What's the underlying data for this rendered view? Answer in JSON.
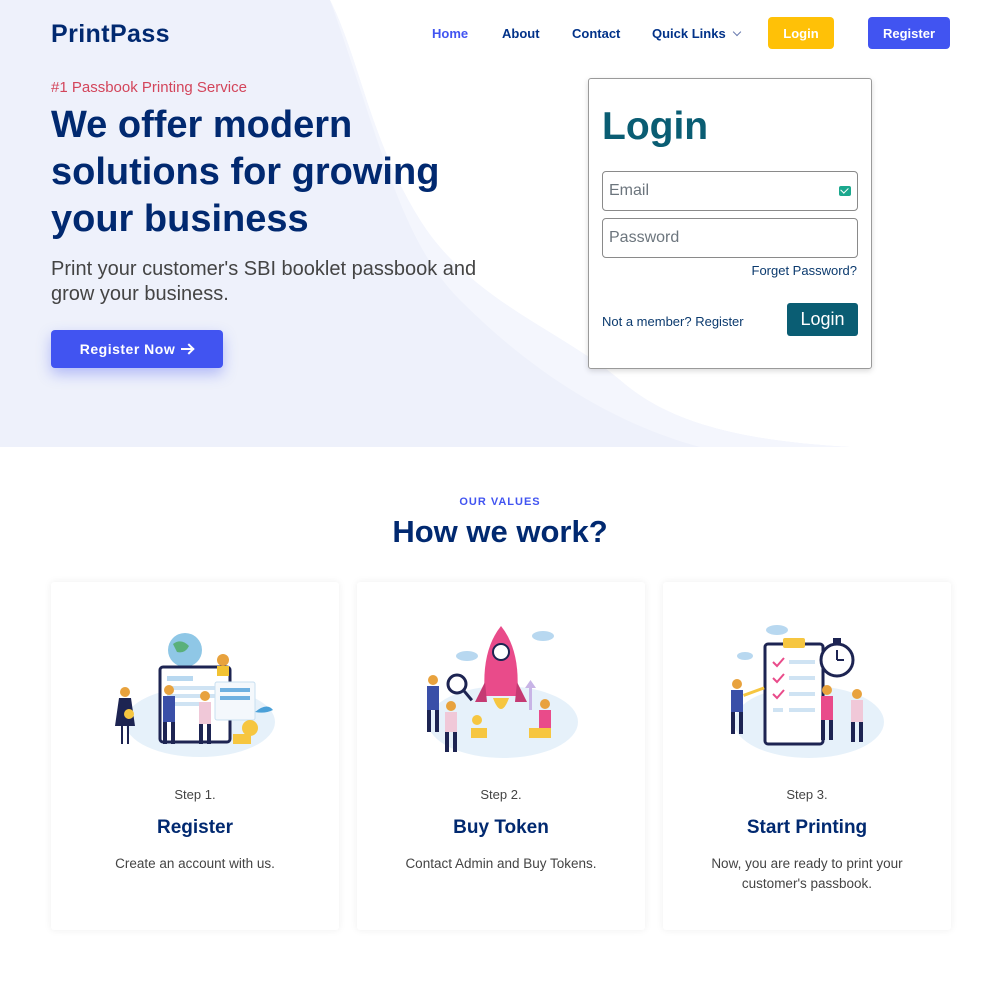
{
  "colors": {
    "primary": "#4154f1",
    "navy": "#012970",
    "teal": "#0a5d73",
    "yellow": "#ffc107",
    "tagline_red": "#d3455b",
    "hero_bg": "#eef1fb"
  },
  "header": {
    "logo": "PrintPass",
    "nav": {
      "home": "Home",
      "about": "About",
      "contact": "Contact",
      "quick_links": "Quick Links"
    },
    "login_button": "Login",
    "register_button": "Register"
  },
  "hero": {
    "tagline": "#1 Passbook Printing Service",
    "headline": "We offer modern solutions for growing your business",
    "subline": "Print your customer's SBI booklet passbook and grow your business.",
    "cta": "Register Now"
  },
  "login_card": {
    "title": "Login",
    "email_placeholder": "Email",
    "password_placeholder": "Password",
    "forget_password": "Forget Password?",
    "not_member": "Not a member? Register",
    "submit": "Login"
  },
  "values": {
    "kicker": "OUR VALUES",
    "title": "How we work?",
    "cards": [
      {
        "step": "Step 1.",
        "title": "Register",
        "description": "Create an account with us.",
        "illustration": "people-dashboard-illustration"
      },
      {
        "step": "Step 2.",
        "title": "Buy Token",
        "description": "Contact Admin and Buy Tokens.",
        "illustration": "rocket-launch-illustration"
      },
      {
        "step": "Step 3.",
        "title": "Start Printing",
        "description": "Now, you are ready to print your customer's passbook.",
        "illustration": "checklist-stopwatch-illustration"
      }
    ]
  }
}
